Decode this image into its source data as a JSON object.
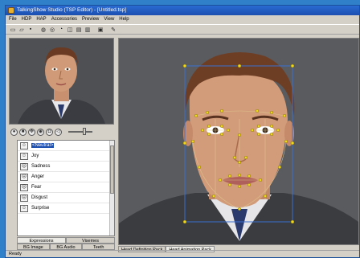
{
  "window": {
    "title": "TalkingShow Studio (TSP Editor) - [Untitled.tsp]"
  },
  "menu": [
    "File",
    "HDP",
    "HAP",
    "Accessories",
    "Preview",
    "View",
    "Help"
  ],
  "toolbar": {
    "icons": [
      "new-icon",
      "open-icon",
      "save-icon",
      "tool-icon-1",
      "tool-icon-2",
      "tool-icon-3",
      "tool-icon-4",
      "tool-icon-5",
      "tool-icon-6",
      "tool-icon-7",
      "tool-icon-8"
    ]
  },
  "expressions": [
    {
      "label": "<Neutral>",
      "selected": true
    },
    {
      "label": "Joy"
    },
    {
      "label": "Sadness"
    },
    {
      "label": "Anger"
    },
    {
      "label": "Fear"
    },
    {
      "label": "Disgust"
    },
    {
      "label": "Surprise"
    }
  ],
  "left_tabs_row1": [
    "Expressions",
    "Visemes"
  ],
  "left_tabs_row2": [
    "BG Image",
    "BG Audio",
    "Teeth"
  ],
  "viewport_tabs": [
    "Head Definition Pack",
    "Head Animation Pack"
  ],
  "status": "Ready",
  "colors": {
    "accent": "#1c4fb0",
    "control_point": "#f1d81c",
    "bounding_box": "#3a6fd0"
  }
}
